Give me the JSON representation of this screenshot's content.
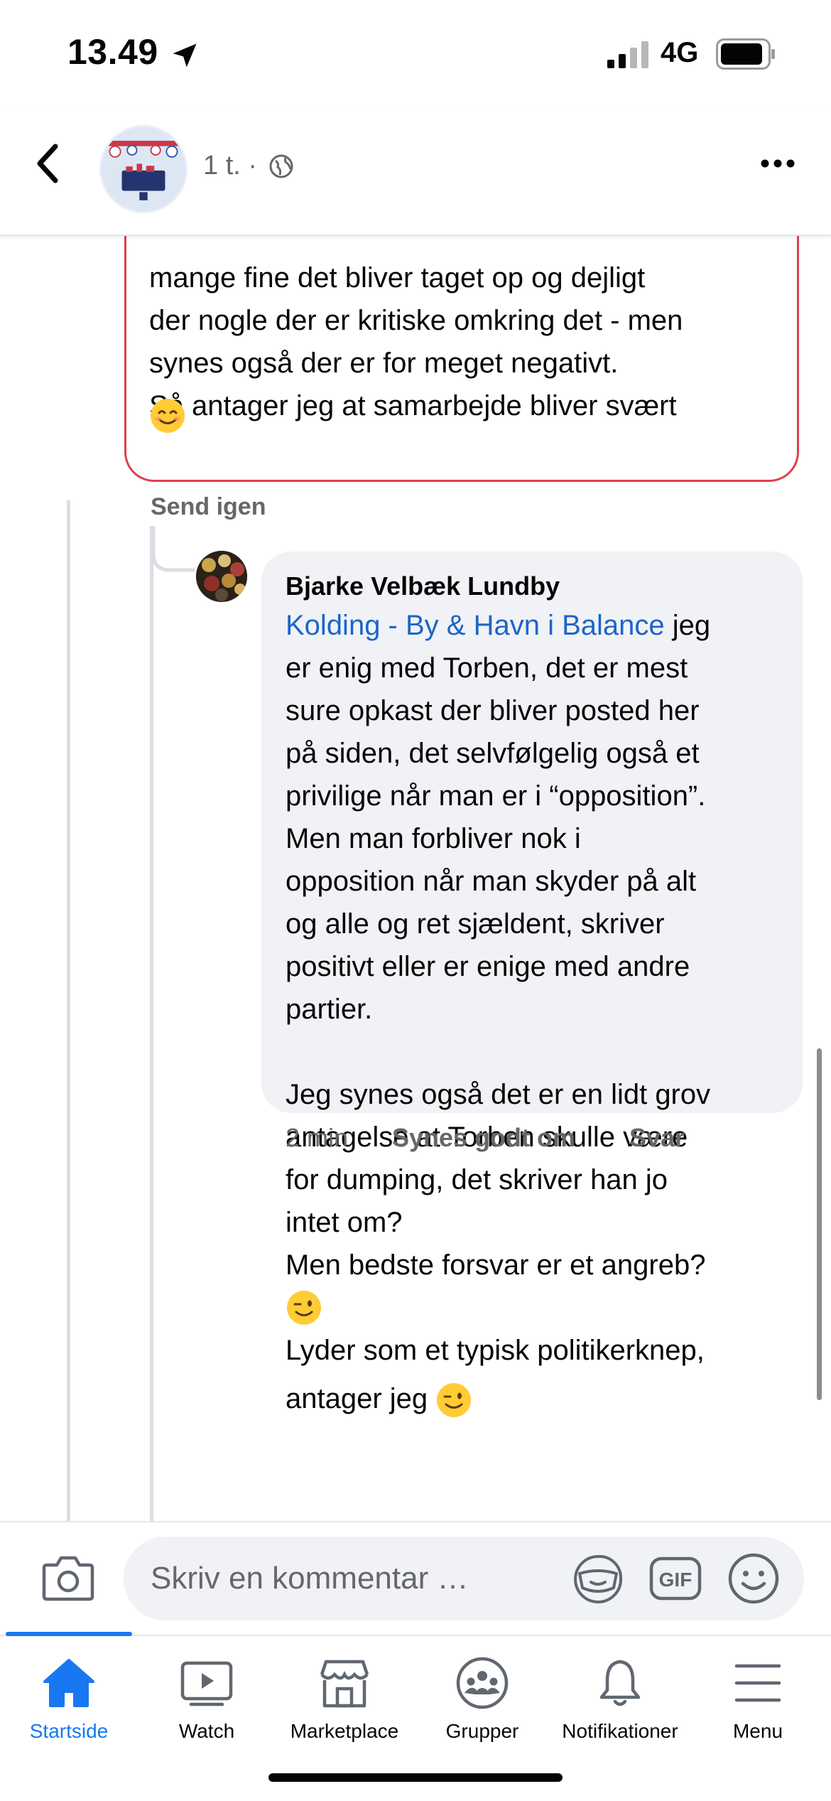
{
  "status_bar": {
    "time": "13.49",
    "network": "4G"
  },
  "header": {
    "post_meta": "1 t. ·"
  },
  "previous_comment": {
    "text": "mange fine det bliver taget op og dejligt\nder nogle der er kritiske omkring det - men\nsynes også der er for meget negativt.\nSå antager jeg at samarbejde bliver svært",
    "send_again_label": "Send igen"
  },
  "reply": {
    "author": "Bjarke Velbæk Lundby",
    "mention": "Kolding - By & Havn i Balance",
    "text_part1": " jeg\ner enig med Torben, det er mest\nsure opkast der bliver posted her\npå siden, det selvfølgelig også et\nprivilige når man er i “opposition”.\nMen man forbliver nok i\nopposition når man skyder på alt\nog alle og ret sjældent, skriver\npositivt eller er enige med andre\npartier.\n\nJeg synes også det er en lidt grov\nantagelse at Torben skulle være\nfor dumping, det skriver han jo\nintet om?\nMen bedste forsvar er et angreb?",
    "text_part2": "Lyder som et typisk politikerknep,",
    "text_part3": "antager jeg ",
    "time": "2 min",
    "like_label": "Synes godt om",
    "reply_label": "Svar"
  },
  "composer": {
    "placeholder": "Skriv en kommentar …"
  },
  "tabs": [
    {
      "label": "Startside",
      "icon": "home-icon",
      "active": true
    },
    {
      "label": "Watch",
      "icon": "watch-icon"
    },
    {
      "label": "Marketplace",
      "icon": "marketplace-icon"
    },
    {
      "label": "Grupper",
      "icon": "groups-icon"
    },
    {
      "label": "Notifikationer",
      "icon": "bell-icon"
    },
    {
      "label": "Menu",
      "icon": "menu-icon"
    }
  ],
  "colors": {
    "accent": "#1877f2",
    "mention": "#1d65c8",
    "alert_border": "#e0404e",
    "bubble": "#f0f2f5",
    "muted": "#65676b"
  }
}
